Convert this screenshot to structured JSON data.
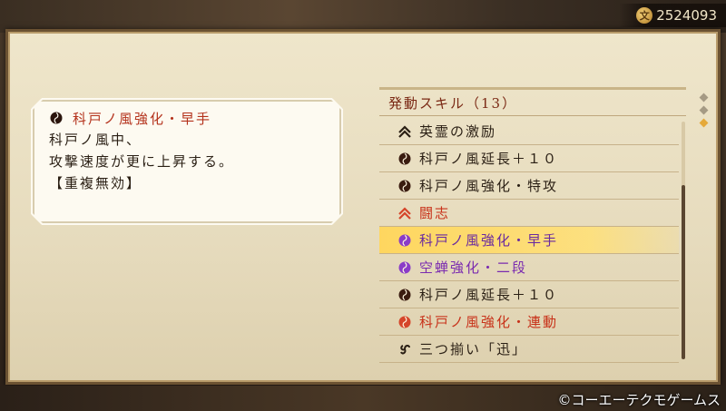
{
  "currency": {
    "icon": "coin-icon",
    "symbol": "文",
    "value": "2524093"
  },
  "description": {
    "title_icon": "magatama-icon",
    "title": "科戸ノ風強化・早手",
    "lines": [
      "科戸ノ風中、",
      "攻撃速度が更に上昇する。",
      "【重複無効】"
    ]
  },
  "skill_panel": {
    "header": "発動スキル（13）",
    "items": [
      {
        "label": "英霊の激励",
        "icon": "chevron-up-icon",
        "color": "#2a1f14",
        "icon_color": "#2a1f14"
      },
      {
        "label": "科戸ノ風延長＋１０",
        "icon": "magatama-icon",
        "color": "#2a1f14",
        "icon_color": "#3a1c10"
      },
      {
        "label": "科戸ノ風強化・特攻",
        "icon": "magatama-icon",
        "color": "#2a1f14",
        "icon_color": "#3a1c10"
      },
      {
        "label": "闘志",
        "icon": "chevron-up-icon",
        "color": "#c8321a",
        "icon_color": "#d5452a"
      },
      {
        "label": "科戸ノ風強化・早手",
        "icon": "magatama-icon",
        "color": "#6a2aa0",
        "icon_color": "#8a3cc8",
        "selected": true
      },
      {
        "label": "空蝉強化・二段",
        "icon": "magatama-icon",
        "color": "#7a2ab0",
        "icon_color": "#8a3cc8"
      },
      {
        "label": "科戸ノ風延長＋１０",
        "icon": "magatama-icon",
        "color": "#2a1f14",
        "icon_color": "#3a1c10"
      },
      {
        "label": "科戸ノ風強化・連動",
        "icon": "magatama-icon",
        "color": "#c8321a",
        "icon_color": "#d5452a"
      },
      {
        "label": "三つ揃い「迅」",
        "icon": "triple-swirl-icon",
        "color": "#2a1f14",
        "icon_color": "#2a1f14"
      }
    ]
  },
  "pager": {
    "pages": 3,
    "active_index": 2
  },
  "copyright": "©コーエーテクモゲームス",
  "colors": {
    "accent_selected": "#ffd65a",
    "frame": "#6b5232",
    "panel_bg": "#efe6cb"
  }
}
